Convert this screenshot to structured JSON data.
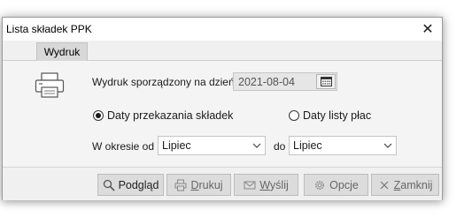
{
  "window": {
    "title": "Lista składek PPK",
    "close_glyph": "✕"
  },
  "tabs": [
    {
      "label": "Wydruk"
    }
  ],
  "form": {
    "printout_date_label": "Wydruk sporządzony na dzień",
    "printout_date_value": "2021-08-04",
    "radio_transfer_label": "Daty przekazania składek",
    "radio_transfer_checked": true,
    "radio_payroll_label": "Daty listy płac",
    "radio_payroll_checked": false,
    "period_from_label": "W okresie od",
    "period_from_value": "Lipiec",
    "period_to_label": "do",
    "period_to_value": "Lipiec"
  },
  "buttons": {
    "preview": {
      "label": "Podgląd",
      "icon": "magnifier-icon"
    },
    "print": {
      "pre": "",
      "ul": "D",
      "post": "rukuj",
      "icon": "printer-icon"
    },
    "send": {
      "pre": "",
      "ul": "W",
      "post": "yślij",
      "icon": "envelope-icon"
    },
    "options": {
      "label": "Opcje",
      "icon": "gear-icon"
    },
    "close": {
      "pre": "",
      "ul": "Z",
      "post": "amknij",
      "icon": "close-x-icon"
    }
  }
}
